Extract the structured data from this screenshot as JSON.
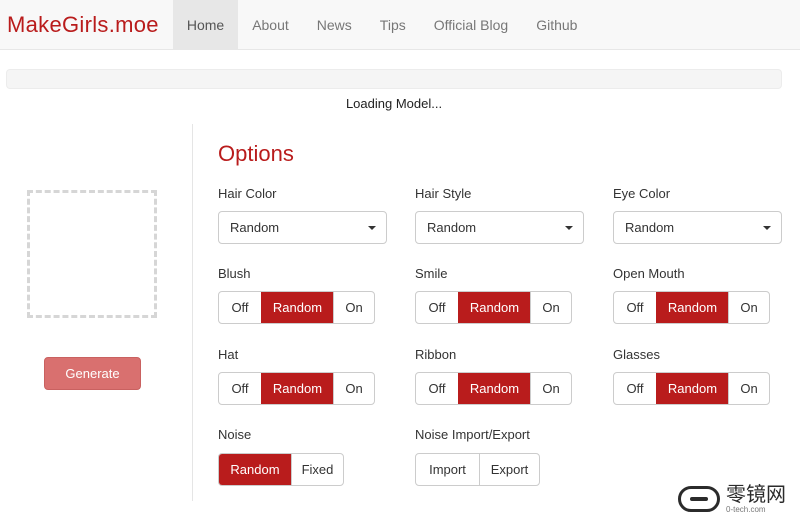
{
  "nav": {
    "brand": "MakeGirls.moe",
    "items": [
      "Home",
      "About",
      "News",
      "Tips",
      "Official Blog",
      "Github"
    ]
  },
  "status": {
    "loading": "Loading Model..."
  },
  "left": {
    "generate_label": "Generate"
  },
  "options": {
    "title": "Options",
    "hair_color": {
      "label": "Hair Color",
      "value": "Random"
    },
    "hair_style": {
      "label": "Hair Style",
      "value": "Random"
    },
    "eye_color": {
      "label": "Eye Color",
      "value": "Random"
    },
    "blush": {
      "label": "Blush",
      "choices": [
        "Off",
        "Random",
        "On"
      ],
      "selected": "Random"
    },
    "smile": {
      "label": "Smile",
      "choices": [
        "Off",
        "Random",
        "On"
      ],
      "selected": "Random"
    },
    "open_mouth": {
      "label": "Open Mouth",
      "choices": [
        "Off",
        "Random",
        "On"
      ],
      "selected": "Random"
    },
    "hat": {
      "label": "Hat",
      "choices": [
        "Off",
        "Random",
        "On"
      ],
      "selected": "Random"
    },
    "ribbon": {
      "label": "Ribbon",
      "choices": [
        "Off",
        "Random",
        "On"
      ],
      "selected": "Random"
    },
    "glasses": {
      "label": "Glasses",
      "choices": [
        "Off",
        "Random",
        "On"
      ],
      "selected": "Random"
    },
    "noise": {
      "label": "Noise",
      "choices": [
        "Random",
        "Fixed"
      ],
      "selected": "Random"
    },
    "noise_io": {
      "label": "Noise Import/Export",
      "choices": [
        "Import",
        "Export"
      ]
    }
  },
  "watermark": {
    "cn": "零镜网",
    "url": "0-tech.com"
  },
  "colors": {
    "accent": "#b91c1c",
    "generate": "#d9706f"
  }
}
